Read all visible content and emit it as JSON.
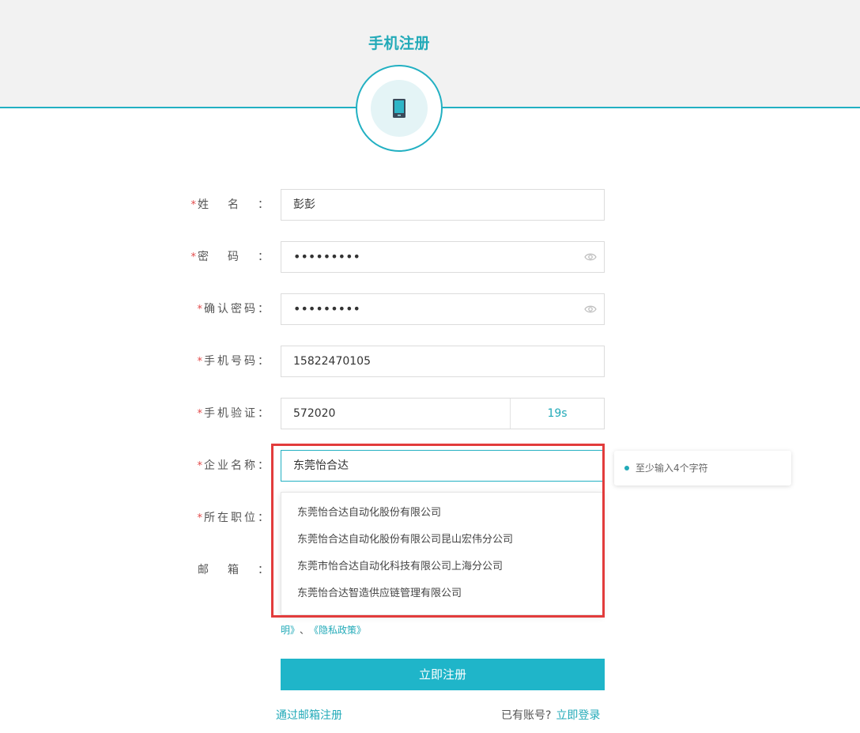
{
  "header": {
    "title": "手机注册"
  },
  "form": {
    "name": {
      "label": "姓名",
      "value": "彭彭"
    },
    "password": {
      "label": "密码",
      "value": "•••••••••"
    },
    "confirm_password": {
      "label": "确认密码",
      "value": "•••••••••"
    },
    "phone": {
      "label": "手机号码",
      "value": "15822470105"
    },
    "verify": {
      "label": "手机验证",
      "value": "572020",
      "countdown": "19s"
    },
    "company": {
      "label": "企业名称",
      "value": "东莞怡合达",
      "tooltip": "至少输入4个字符"
    },
    "position": {
      "label": "所在职位"
    },
    "email": {
      "label": "邮箱"
    },
    "required_mark": "*",
    "colon": "："
  },
  "dropdown": {
    "options": [
      "东莞怡合达自动化股份有限公司",
      "东莞怡合达自动化股份有限公司昆山宏伟分公司",
      "东莞市怡合达自动化科技有限公司上海分公司",
      "东莞怡合达智造供应链管理有限公司"
    ]
  },
  "agreement": {
    "part1": "明》",
    "separator": "、",
    "privacy": "《隐私政策》"
  },
  "actions": {
    "submit": "立即注册",
    "email_register": "通过邮箱注册",
    "has_account": "已有账号?",
    "login": "立即登录"
  },
  "colors": {
    "accent": "#22b0c2",
    "button": "#1fb5c9",
    "required": "#e24a4a",
    "highlight": "#e23c3c"
  }
}
